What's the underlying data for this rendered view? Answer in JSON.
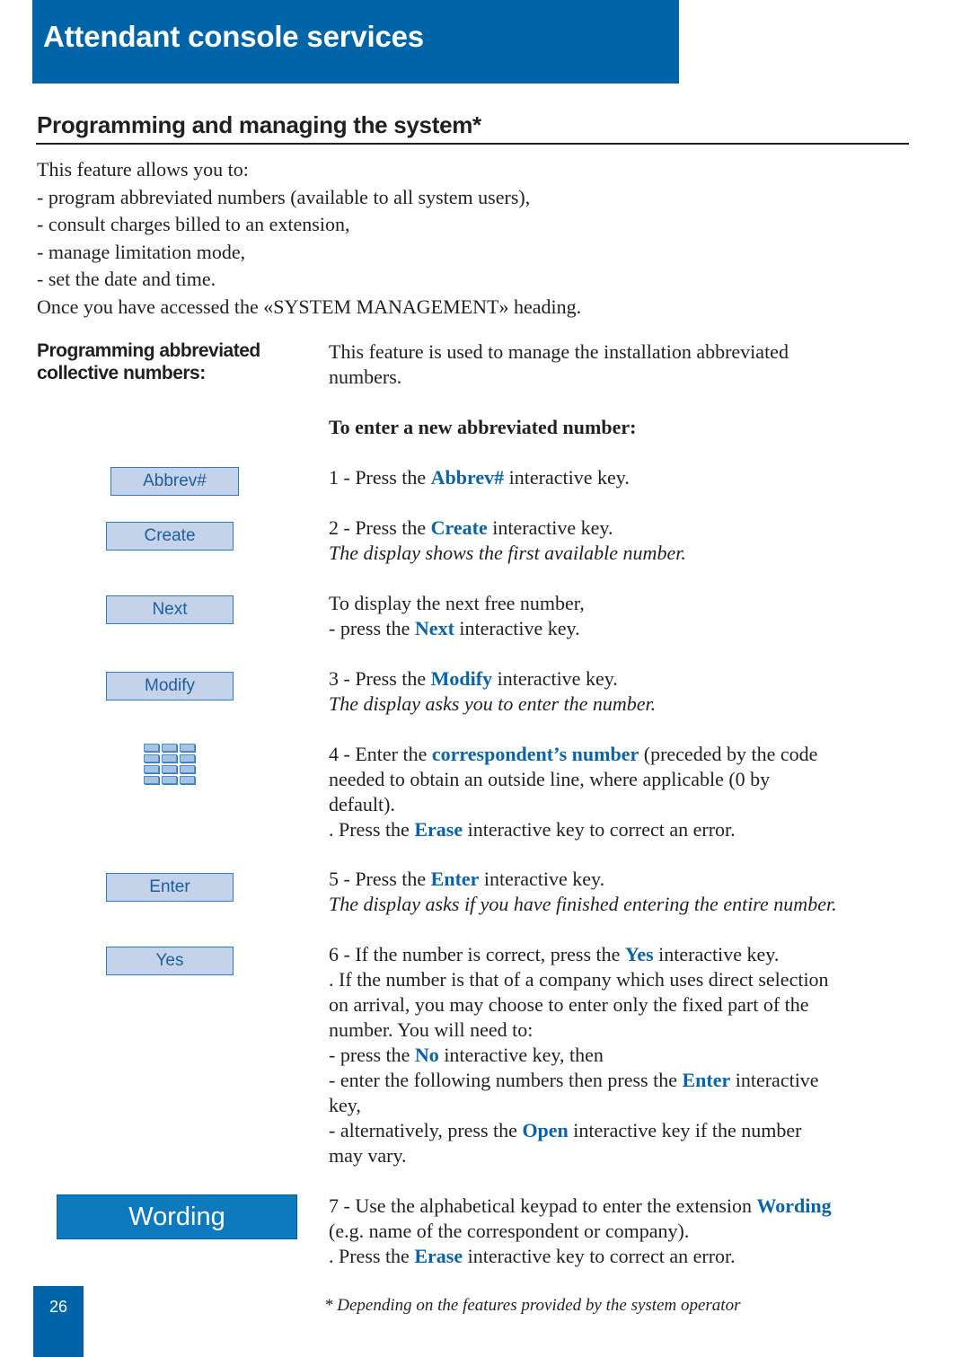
{
  "header": {
    "title": "Attendant console services"
  },
  "section": {
    "title": "Programming and managing the system*"
  },
  "intro": {
    "lead": "This feature allows you to:",
    "items": [
      "- program abbreviated numbers (available to all system users),",
      "- consult charges billed to an extension,",
      "- manage limitation mode,",
      "- set the date and time."
    ],
    "closing": "Once you have accessed the «SYSTEM MANAGEMENT» heading."
  },
  "subsection": {
    "heading_line1": "Programming abbreviated",
    "heading_line2": "collective numbers:",
    "description_line1": "This feature is used to manage the installation abbreviated",
    "description_line2": "numbers.",
    "procedure_title": "To enter a new abbreviated number:"
  },
  "softkeys": {
    "abbrev": "Abbrev#",
    "create": "Create",
    "next": "Next",
    "modify": "Modify",
    "enter": "Enter",
    "yes": "Yes",
    "wording": "Wording",
    "keypad_icon": "numeric-keypad-icon"
  },
  "steps": {
    "s1": {
      "pre": "1 - Press the ",
      "kw": "Abbrev#",
      "post": " interactive key."
    },
    "s2": {
      "pre": "2 - Press the ",
      "kw": "Create",
      "post": " interactive key.",
      "note": "The display shows the first available number."
    },
    "next": {
      "line1": "To display the next free number,",
      "pre": "- press the ",
      "kw": "Next",
      "post": " interactive key."
    },
    "s3": {
      "pre": "3 - Press the ",
      "kw": "Modify",
      "post": " interactive key.",
      "note": "The display asks you to enter the number."
    },
    "s4": {
      "pre": "4 - Enter the ",
      "kw": "correspondent’s number",
      "post": " (preceded by the code",
      "line2": "needed to obtain an outside line, where applicable (0 by",
      "line3": "default).",
      "erase_pre": ". Press the ",
      "erase_kw": "Erase",
      "erase_post": " interactive key to correct an error."
    },
    "s5": {
      "pre": "5 - Press the ",
      "kw": "Enter",
      "post": " interactive key.",
      "note": "The display asks if you have finished entering the entire number."
    },
    "s6": {
      "pre": "6 - If the number is correct, press the ",
      "kw": "Yes",
      "post": " interactive key.",
      "line2": ". If the number is that of a company which uses direct selection",
      "line3": "on arrival, you may choose to enter only the fixed part of the",
      "line4": "number. You will need to:",
      "no_pre": "- press the ",
      "no_kw": "No",
      "no_post": " interactive key, then",
      "enter_pre": "- enter the following numbers then press the ",
      "enter_kw": "Enter",
      "enter_post": " interactive",
      "enter_line2": "key,",
      "open_pre": "- alternatively, press the ",
      "open_kw": "Open",
      "open_post": " interactive key if the number",
      "open_line2": "may vary."
    },
    "s7": {
      "pre": "7 - Use the alphabetical keypad to enter the extension ",
      "kw": "Wording",
      "line2": "(e.g. name of the correspondent or company).",
      "erase_pre": ". Press the ",
      "erase_kw": "Erase",
      "erase_post": " interactive key to correct an error."
    }
  },
  "footer": {
    "page_number": "26",
    "footnote": "* Depending on the features provided by the system operator"
  },
  "colors": {
    "brand_blue": "#0064a8",
    "keyword_blue": "#0a63a8",
    "softkey_fill": "#c5d3ea"
  }
}
